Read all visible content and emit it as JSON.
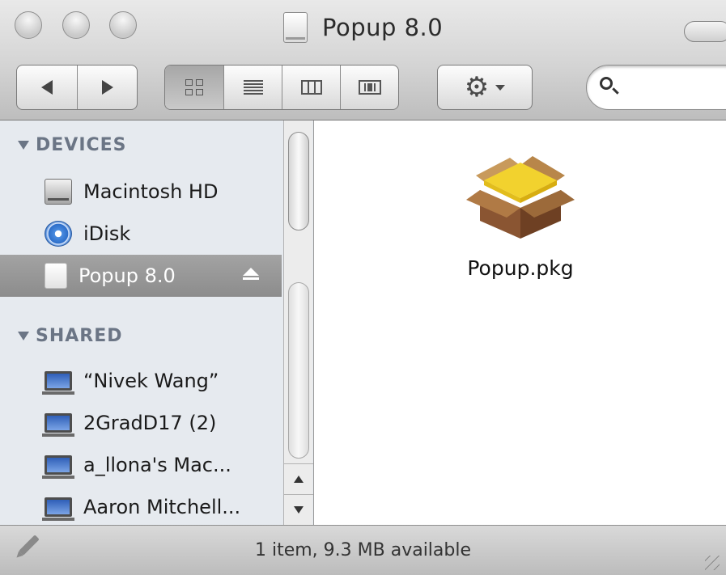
{
  "window": {
    "title": "Popup 8.0"
  },
  "toolbar": {
    "back_icon": "back-arrow-icon",
    "forward_icon": "forward-arrow-icon",
    "views": [
      "icon-view",
      "list-view",
      "column-view",
      "coverflow-view"
    ],
    "active_view": "icon-view",
    "action_icon": "gear-icon",
    "search_value": ""
  },
  "sidebar": {
    "devices_header": "DEVICES",
    "devices": [
      {
        "label": "Macintosh HD",
        "icon": "hard-drive-icon"
      },
      {
        "label": "iDisk",
        "icon": "idisk-icon"
      },
      {
        "label": "Popup 8.0",
        "icon": "disk-image-icon",
        "selected": true
      }
    ],
    "shared_header": "SHARED",
    "shared": [
      {
        "label": "“Nivek Wang”",
        "icon": "network-computer-icon"
      },
      {
        "label": "2GradD17 (2)",
        "icon": "network-computer-icon"
      },
      {
        "label": "a_llona's Mac...",
        "icon": "network-computer-icon"
      },
      {
        "label": "Aaron Mitchell...",
        "icon": "network-computer-icon"
      }
    ]
  },
  "content": {
    "files": [
      {
        "label": "Popup.pkg",
        "icon": "package-icon"
      }
    ]
  },
  "status": {
    "text": "1 item, 9.3 MB available"
  },
  "colors": {
    "sidebar_bg": "#e6eaef",
    "selection": "#999999",
    "section_header": "#6b7585"
  }
}
